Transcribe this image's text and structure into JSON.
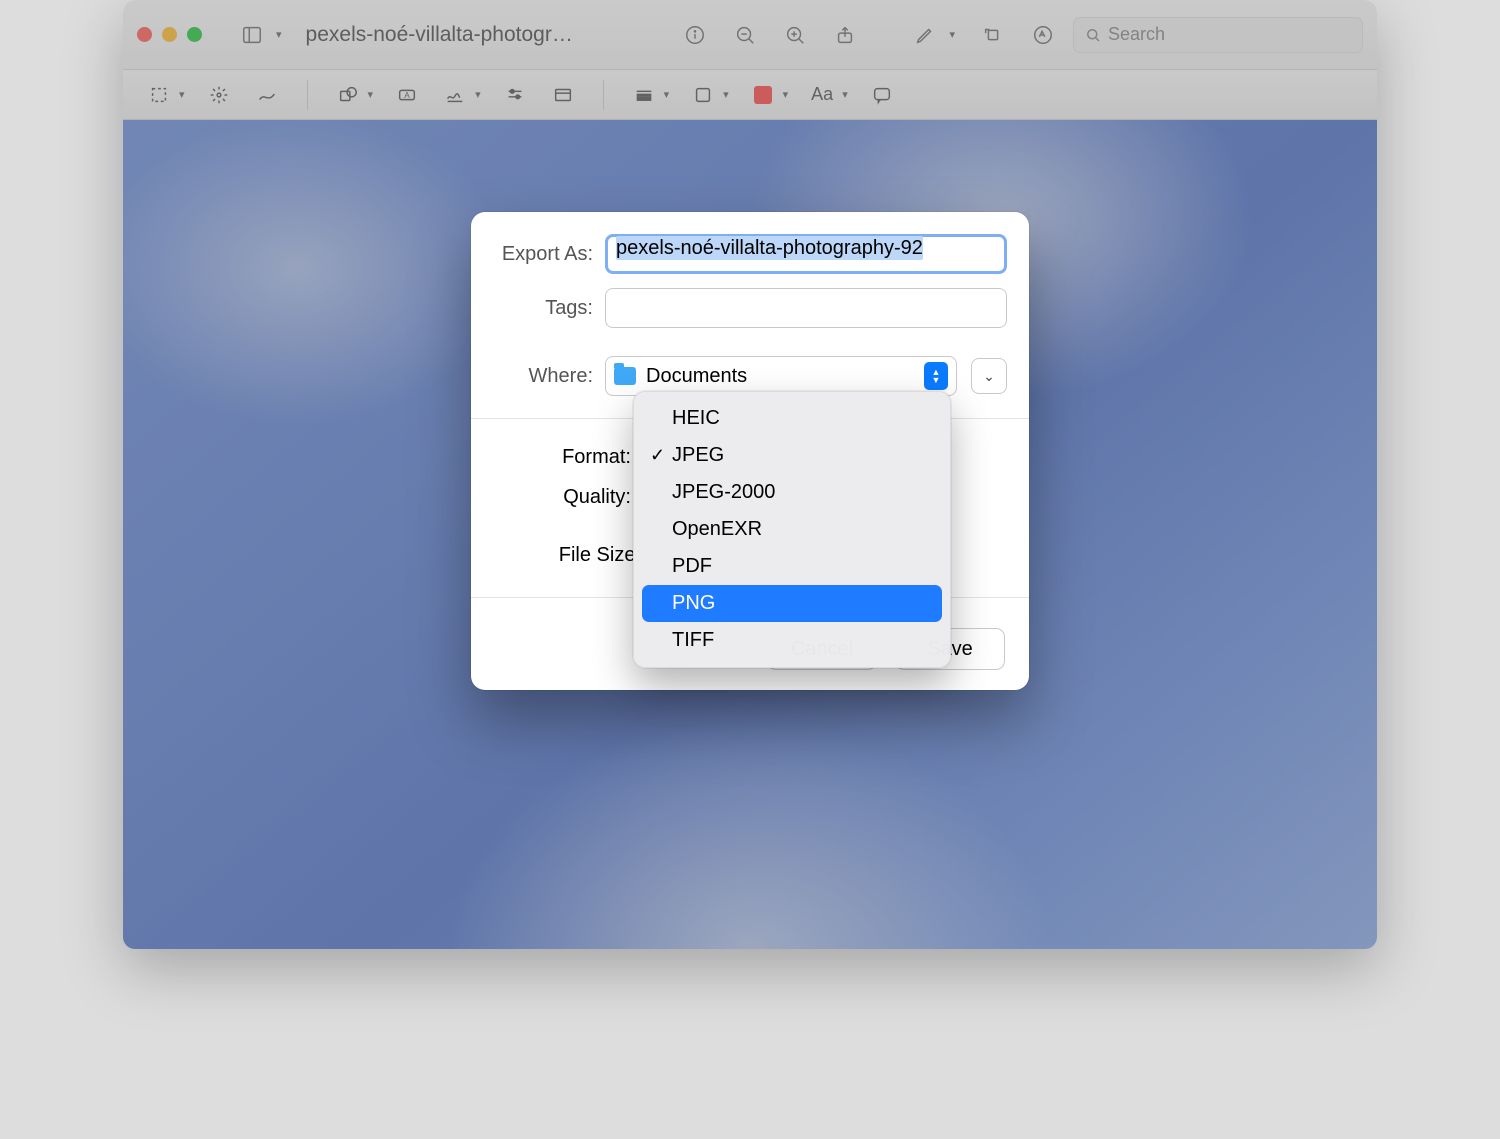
{
  "titlebar": {
    "document_title": "pexels-noé-villalta-photogr…",
    "search_placeholder": "Search"
  },
  "sheet": {
    "labels": {
      "export_as": "Export As:",
      "tags": "Tags:",
      "where": "Where:",
      "format": "Format:",
      "quality": "Quality:",
      "file_size": "File Size:"
    },
    "export_as_value": "pexels-noé-villalta-photography-92",
    "tags_value": "",
    "where_value": "Documents",
    "buttons": {
      "cancel": "Cancel",
      "save": "Save"
    }
  },
  "format_menu": {
    "checked": "JPEG",
    "highlighted": "PNG",
    "items": [
      "HEIC",
      "JPEG",
      "JPEG-2000",
      "OpenEXR",
      "PDF",
      "PNG",
      "TIFF"
    ]
  }
}
